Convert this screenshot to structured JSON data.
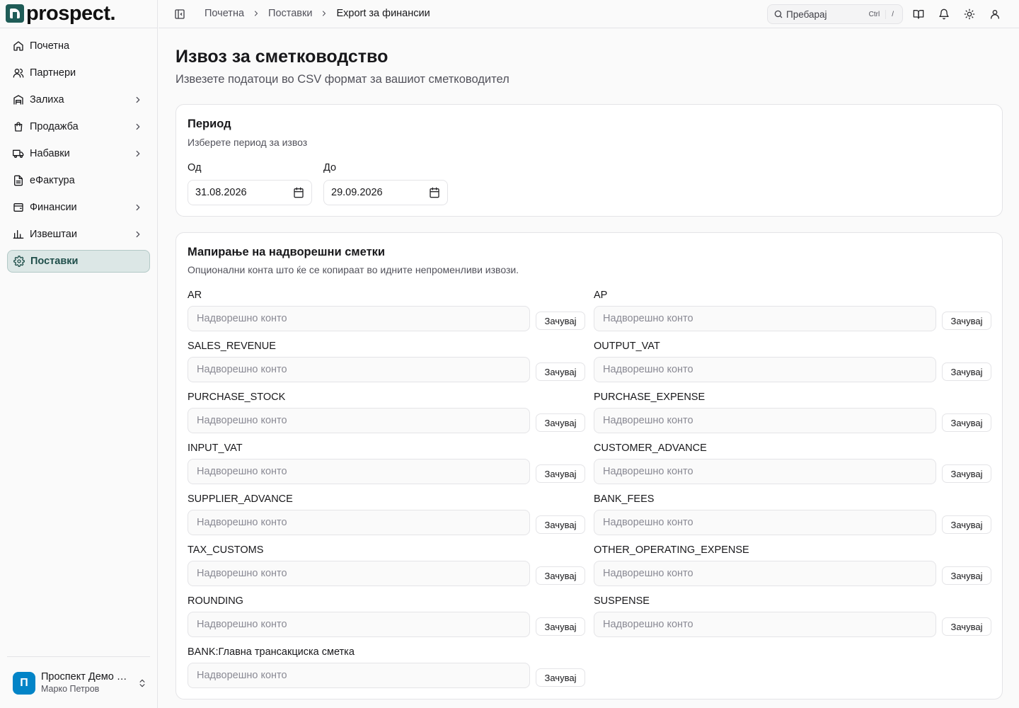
{
  "app": {
    "logo_text": "prospect."
  },
  "sidebar": {
    "items": [
      {
        "label": "Почетна",
        "icon": "home-icon",
        "expandable": false,
        "active": false
      },
      {
        "label": "Партнери",
        "icon": "users-icon",
        "expandable": false,
        "active": false
      },
      {
        "label": "Залиха",
        "icon": "warehouse-icon",
        "expandable": true,
        "active": false
      },
      {
        "label": "Продажба",
        "icon": "shopping-bag-icon",
        "expandable": true,
        "active": false
      },
      {
        "label": "Набавки",
        "icon": "truck-icon",
        "expandable": true,
        "active": false
      },
      {
        "label": "еФактура",
        "icon": "file-text-icon",
        "expandable": false,
        "active": false
      },
      {
        "label": "Финансии",
        "icon": "wallet-icon",
        "expandable": true,
        "active": false
      },
      {
        "label": "Извештаи",
        "icon": "bar-chart-icon",
        "expandable": true,
        "active": false
      },
      {
        "label": "Поставки",
        "icon": "settings-icon",
        "expandable": false,
        "active": true
      }
    ],
    "user": {
      "initial": "П",
      "org": "Проспект Демо Компанија",
      "name": "Марко Петров"
    }
  },
  "header": {
    "breadcrumb": [
      "Почетна",
      "Поставки",
      "Export за финансии"
    ],
    "search": {
      "label": "Пребарај",
      "kbd1": "Ctrl",
      "kbd2": "/"
    }
  },
  "page": {
    "title": "Извоз за сметководство",
    "subtitle": "Извезете податоци во CSV формат за вашиот сметководител"
  },
  "period": {
    "title": "Период",
    "description": "Изберете период за извоз",
    "from_label": "Од",
    "from_value": "31.08.2026",
    "to_label": "До",
    "to_value": "29.09.2026"
  },
  "mapping": {
    "title": "Мапирање на надворешни сметки",
    "description": "Опционални конта што ќе се копираат во идните непроменливи извози.",
    "placeholder": "Надворешно конто",
    "save_label": "Зачувај",
    "accounts": [
      "AR",
      "AP",
      "SALES_REVENUE",
      "OUTPUT_VAT",
      "PURCHASE_STOCK",
      "PURCHASE_EXPENSE",
      "INPUT_VAT",
      "CUSTOMER_ADVANCE",
      "SUPPLIER_ADVANCE",
      "BANK_FEES",
      "TAX_CUSTOMS",
      "OTHER_OPERATING_EXPENSE",
      "ROUNDING",
      "SUSPENSE",
      "BANK:Главна трансакциска сметка"
    ]
  },
  "colors": {
    "accent": "#1f5c57",
    "active_bg": "#dce7e6",
    "avatar": "#0284c7"
  }
}
